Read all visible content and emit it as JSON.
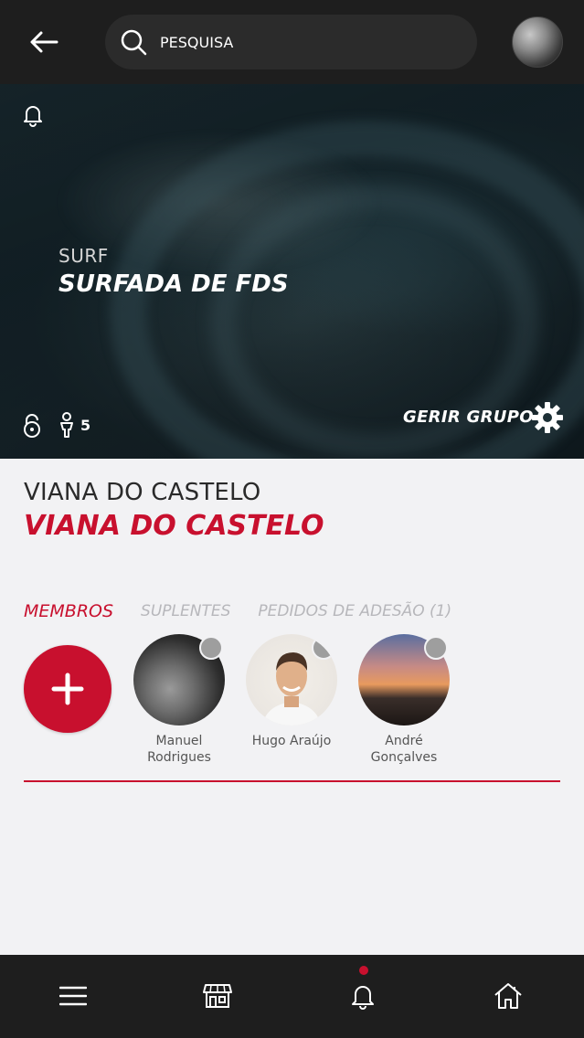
{
  "search": {
    "placeholder": "PESQUISA"
  },
  "hero": {
    "sport": "SURF",
    "group_name": "SURFADA DE FDS",
    "members_count": "5",
    "manage_label": "GERIR GRUPO"
  },
  "location": {
    "label": "VIANA DO CASTELO",
    "title": "VIANA DO CASTELO"
  },
  "tabs": [
    {
      "label": "MEMBROS",
      "active": true
    },
    {
      "label": "SUPLENTES",
      "active": false
    },
    {
      "label": "PEDIDOS DE ADESÃO  (1)",
      "active": false
    }
  ],
  "members": [
    {
      "name_line1": "Manuel",
      "name_line2": "Rodrigues"
    },
    {
      "name_line1": "Hugo Araújo",
      "name_line2": ""
    },
    {
      "name_line1": "André",
      "name_line2": "Gonçalves"
    }
  ],
  "colors": {
    "accent": "#c8102e",
    "topbar": "#1e1e1e",
    "background": "#f2f2f4"
  },
  "icons": [
    "back-arrow-icon",
    "search-icon",
    "bell-icon",
    "unlock-icon",
    "person-icon",
    "gear-icon",
    "plus-icon",
    "menu-icon",
    "store-icon",
    "home-icon"
  ]
}
